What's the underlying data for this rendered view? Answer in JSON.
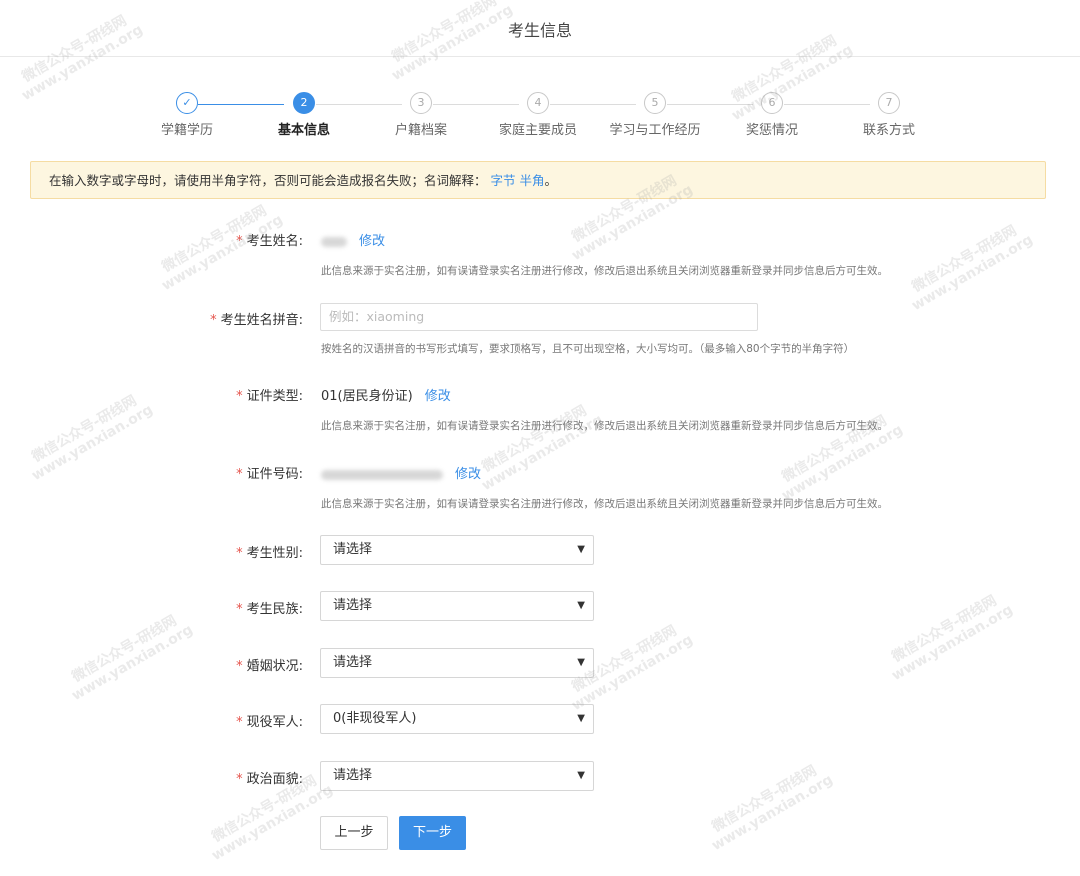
{
  "header": {
    "title": "考生信息"
  },
  "steps": [
    {
      "label": "学籍学历",
      "num": "✓",
      "state": "done"
    },
    {
      "label": "基本信息",
      "num": "2",
      "state": "active"
    },
    {
      "label": "户籍档案",
      "num": "3",
      "state": "todo"
    },
    {
      "label": "家庭主要成员",
      "num": "4",
      "state": "todo"
    },
    {
      "label": "学习与工作经历",
      "num": "5",
      "state": "todo"
    },
    {
      "label": "奖惩情况",
      "num": "6",
      "state": "todo"
    },
    {
      "label": "联系方式",
      "num": "7",
      "state": "todo"
    }
  ],
  "notice": {
    "text": "在输入数字或字母时，请使用半角字符，否则可能会造成报名失败；名词解释：",
    "link1": "字节",
    "link2": "半角",
    "end": "。"
  },
  "form": {
    "required_mark": "*",
    "name": {
      "label": "考生姓名:",
      "edit": "修改",
      "hint": "此信息来源于实名注册，如有误请登录实名注册进行修改，修改后退出系统且关闭浏览器重新登录并同步信息后方可生效。"
    },
    "pinyin": {
      "label": "考生姓名拼音:",
      "placeholder": "例如：xiaoming",
      "hint": "按姓名的汉语拼音的书写形式填写，要求顶格写，且不可出现空格，大小写均可。（最多输入80个字节的半角字符）"
    },
    "id_type": {
      "label": "证件类型:",
      "value": "01(居民身份证)",
      "edit": "修改",
      "hint": "此信息来源于实名注册，如有误请登录实名注册进行修改，修改后退出系统且关闭浏览器重新登录并同步信息后方可生效。"
    },
    "id_number": {
      "label": "证件号码:",
      "edit": "修改",
      "hint": "此信息来源于实名注册，如有误请登录实名注册进行修改，修改后退出系统且关闭浏览器重新登录并同步信息后方可生效。"
    },
    "gender": {
      "label": "考生性别:",
      "value": "请选择"
    },
    "ethnicity": {
      "label": "考生民族:",
      "value": "请选择"
    },
    "marital": {
      "label": "婚姻状况:",
      "value": "请选择"
    },
    "military": {
      "label": "现役军人:",
      "value": "0(非现役军人)"
    },
    "political": {
      "label": "政治面貌:",
      "value": "请选择"
    }
  },
  "buttons": {
    "prev": "上一步",
    "next": "下一步"
  },
  "watermark": {
    "line1": "微信公众号-研线网",
    "line2": "www.yanxian.org"
  },
  "colors": {
    "accent": "#3a8ee6",
    "required": "#e5534b",
    "notice_bg": "#fdf6e0"
  }
}
